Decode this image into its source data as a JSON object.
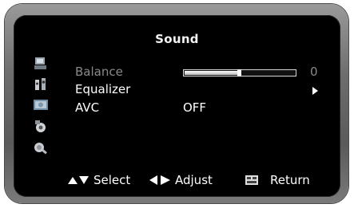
{
  "menu": {
    "title": "Sound",
    "items": [
      {
        "label": "Balance",
        "value": "0",
        "level": 0.5,
        "enabled": false
      },
      {
        "label": "Equalizer"
      },
      {
        "label": "AVC",
        "value": "OFF"
      }
    ]
  },
  "sidebar": {
    "icons": [
      "picture-icon",
      "sound-icon",
      "screen-icon",
      "settings-icon",
      "feature-icon"
    ]
  },
  "footer": {
    "select_label": "Select",
    "adjust_label": "Adjust",
    "return_label": "Return"
  }
}
